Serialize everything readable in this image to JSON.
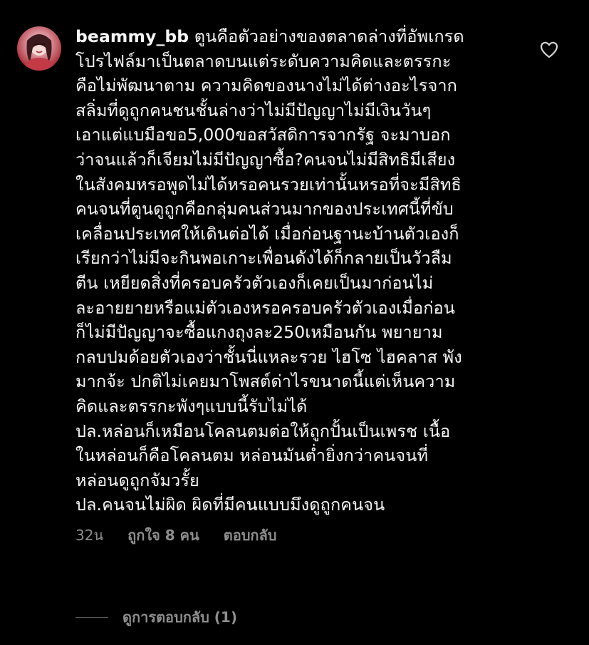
{
  "comment": {
    "username": "beammy_bb",
    "text_lines": [
      "ตูนคือตัวอย่างของตลาดล่างที่อัพเกรด",
      "โปรไฟล์มาเป็นตลาดบนแต่ระดับความคิดและตรรกะ",
      "คือไม่พัฒนาตาม ความคิดของนางไม่ได้ต่างอะไรจาก",
      "สลิ่มที่ดูถูกคนชนชั้นล่างว่าไม่มีปัญญาไม่มีเงินวันๆ",
      "เอาแต่แบมือขอ5,000ขอสวัสดิการจากรัฐ จะมาบอก",
      "ว่าจนแล้วก็เจียมไม่มีปัญญาซื้อ?คนจนไม่มีสิทธิมีเสียง",
      "ในสังคมหรอพูดไม่ได้หรอคนรวยเท่านั้นหรอที่จะมีสิทธิ",
      "คนจนที่ตูนดูถูกคือกลุ่มคนส่วนมากของประเทศนี้ที่ขับ",
      "เคลื่อนประเทศให้เดินต่อได้ เมื่อก่อนฐานะบ้านตัวเองก็",
      "เรียกว่าไม่มีจะกินพอเกาะเพื่อนดังได้ก็กลายเป็นวัวลืม",
      "ตีน เหยียดสิ่งที่ครอบครัวตัวเองก็เคยเป็นมาก่อนไม่",
      "ละอายยายหรือแม่ตัวเองหรอครอบครัวตัวเองเมื่อก่อน",
      "ก็ไม่มีปัญญาจะซื้อแกงถุงละ250เหมือนกัน พยายาม",
      "กลบปมด้อยตัวเองว่าชั้นนี่แหละรวย ไฮโซ ไฮคลาส พัง",
      "มากจ้ะ ปกติไม่เคยมาโพสต์ด่าไรขนาดนี้แต่เห็นความ",
      "คิดและตรรกะพังๆแบบนี้รับไม่ได้"
    ],
    "ps1_lines": [
      "ปล.หล่อนก็เหมือนโคลนตมต่อให้ถูกปั้นเป็นเพรช เนื้อ",
      "ในหล่อนก็คือโคลนตม หล่อนมันต่ำยิ่งกว่าคนจนที่",
      "หล่อนดูถูกจัมวรั้ย"
    ],
    "ps2_lines": [
      "ปล.คนจนไม่ผิด ผิดที่มีคนแบบมึงดูถูกคนจน"
    ],
    "time": "32น",
    "likes": "ถูกใจ 8 คน",
    "reply_label": "ตอบกลับ"
  },
  "view_replies_label": "ดูการตอบกลับ (1)",
  "colors": {
    "background": "#000000",
    "text": "#f5f5f5",
    "muted": "#8e8e8e"
  }
}
